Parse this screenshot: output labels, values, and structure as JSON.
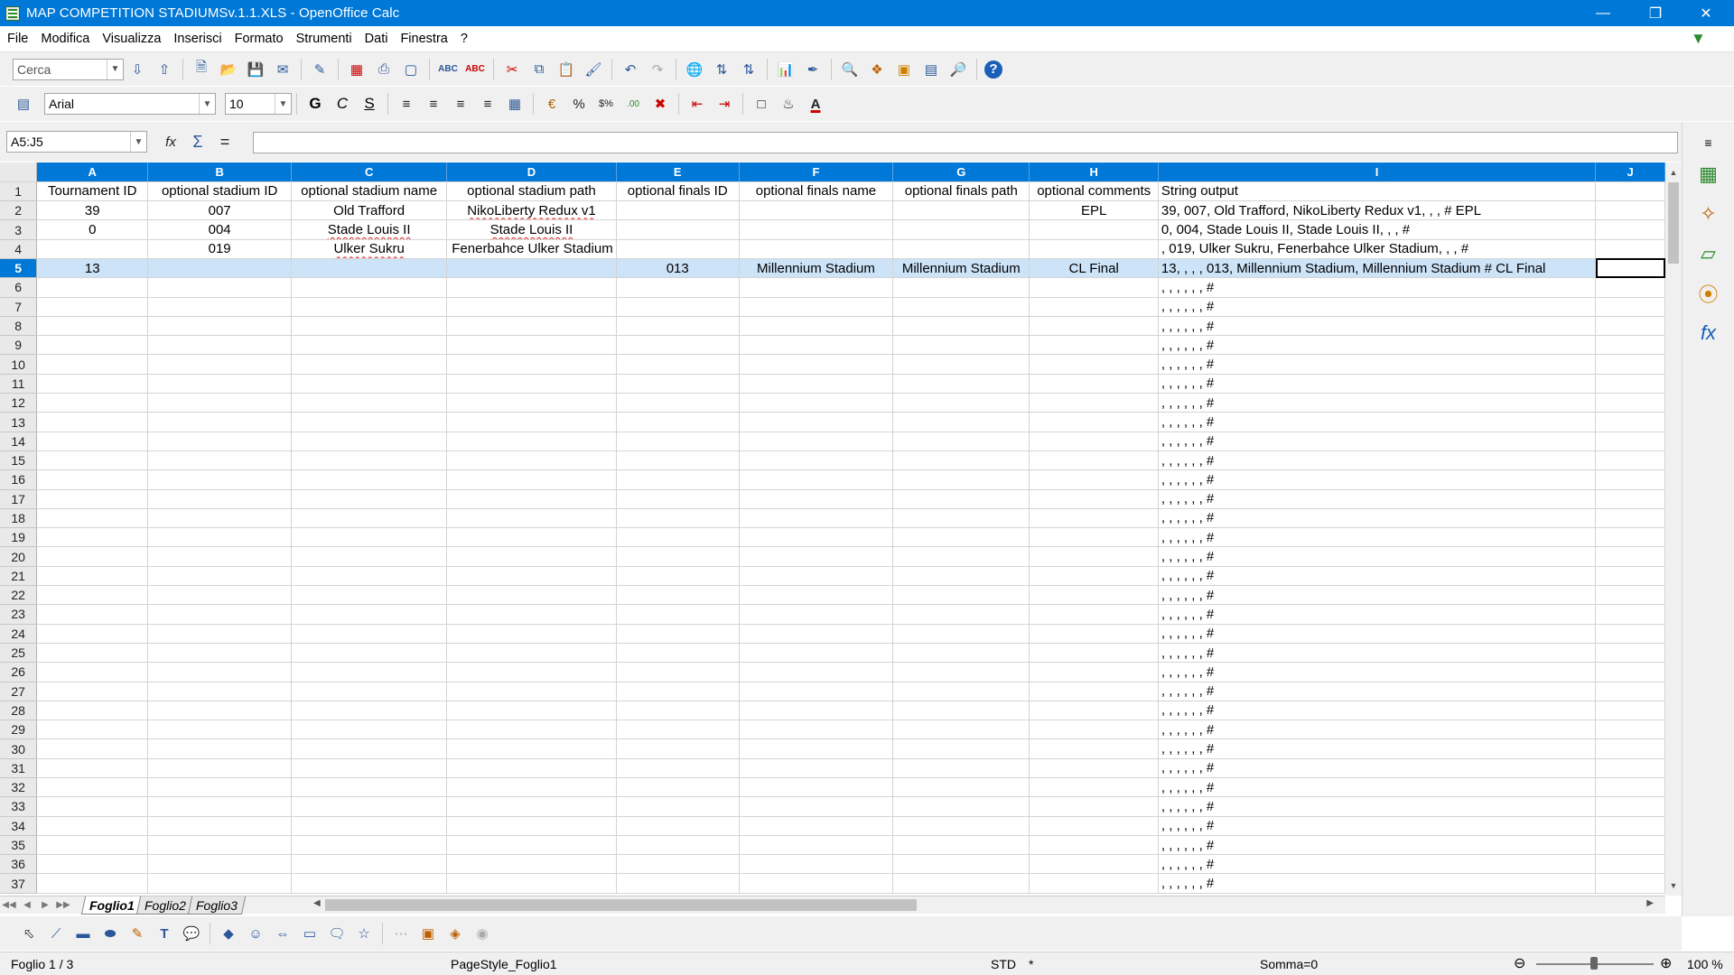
{
  "window": {
    "title": "MAP COMPETITION STADIUMSv.1.1.XLS - OpenOffice Calc"
  },
  "menu": [
    "File",
    "Modifica",
    "Visualizza",
    "Inserisci",
    "Formato",
    "Strumenti",
    "Dati",
    "Finestra",
    "?"
  ],
  "toolbar": {
    "search_placeholder": "Cerca",
    "font_name": "Arial",
    "font_size": "10"
  },
  "formula_bar": {
    "name_box": "A5:J5",
    "content": ""
  },
  "columns": [
    "A",
    "B",
    "C",
    "D",
    "E",
    "F",
    "G",
    "H",
    "I",
    "J"
  ],
  "rows": [
    {
      "n": "1",
      "cells": [
        "Tournament ID",
        "optional stadium ID",
        "optional stadium name",
        "optional stadium path",
        "optional finals ID",
        "optional finals name",
        "optional finals path",
        "optional comments",
        "String output",
        ""
      ]
    },
    {
      "n": "2",
      "cells": [
        "39",
        "007",
        "Old Trafford",
        "NikoLiberty Redux v1",
        "",
        "",
        "",
        "EPL",
        "39, 007, Old Trafford, NikoLiberty Redux v1, , ,  #  EPL",
        ""
      ]
    },
    {
      "n": "3",
      "cells": [
        "0",
        "004",
        "Stade Louis II",
        "Stade Louis II",
        "",
        "",
        "",
        "",
        "0, 004, Stade Louis II, Stade Louis II, , ,  #",
        ""
      ]
    },
    {
      "n": "4",
      "cells": [
        "",
        "019",
        "Ulker Sukru",
        "Fenerbahce Ulker Stadium",
        "",
        "",
        "",
        "",
        ", 019, Ulker Sukru, Fenerbahce Ulker Stadium, , ,  #",
        ""
      ]
    },
    {
      "n": "5",
      "cells": [
        "13",
        "",
        "",
        "",
        "013",
        "Millennium Stadium",
        "Millennium Stadium",
        "CL Final",
        "13, , , , 013, Millennium Stadium, Millennium Stadium #  CL Final",
        ""
      ]
    }
  ],
  "empty_output": ", , , , , ,  #",
  "empty_row_numbers": [
    "6",
    "7",
    "8",
    "9",
    "10",
    "11",
    "12",
    "13",
    "14",
    "15",
    "16",
    "17",
    "18",
    "19",
    "20",
    "21",
    "22",
    "23",
    "24",
    "25",
    "26",
    "27",
    "28",
    "29",
    "30",
    "31",
    "32",
    "33",
    "34",
    "35",
    "36",
    "37"
  ],
  "sheets": [
    "Foglio1",
    "Foglio2",
    "Foglio3"
  ],
  "active_sheet": "Foglio1",
  "status": {
    "sheet": "Foglio 1 / 3",
    "page_style": "PageStyle_Foglio1",
    "mode": "STD",
    "modified": "*",
    "sum": "Somma=0",
    "zoom": "100 %"
  }
}
